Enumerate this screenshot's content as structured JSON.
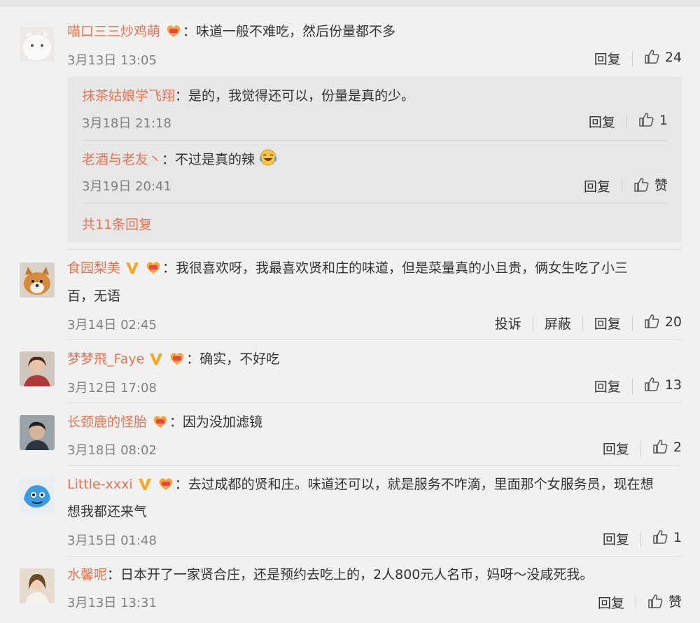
{
  "comments": [
    {
      "user": "喵口三三炒鸡萌",
      "text": "：味道一般不难吃，然后份量都不多",
      "time": "3月13日 13:05",
      "actions": [
        "回复"
      ],
      "likes": "24",
      "replies": [
        {
          "user": "抹茶姑娘学飞翔",
          "text": "：是的，我觉得还可以，份量是真的少。",
          "time": "3月18日 21:18",
          "reply": "回复",
          "likes": "1"
        },
        {
          "user": "老酒与老友丶",
          "text": "：不过是真的辣",
          "time": "3月19日 20:41",
          "reply": "回复",
          "likes": "赞"
        }
      ],
      "more_replies": "共11条回复"
    },
    {
      "user": "食园梨美",
      "text": "：我很喜欢呀，我最喜欢贤和庄的味道，但是菜量真的小且贵，俩女生吃了小三",
      "text2": "百，无语",
      "time": "3月14日 02:45",
      "actions": [
        "投诉",
        "屏蔽",
        "回复"
      ],
      "likes": "20"
    },
    {
      "user": "梦梦飛_Faye",
      "text": "：确实，不好吃",
      "time": "3月12日 17:08",
      "actions": [
        "回复"
      ],
      "likes": "13"
    },
    {
      "user": "长颈鹿的怪胎",
      "text": "：因为没加滤镜",
      "time": "3月18日 08:02",
      "actions": [
        "回复"
      ],
      "likes": "2"
    },
    {
      "user": "Little-xxxi",
      "text": "：去过成都的贤和庄。味道还可以，就是服务不咋滴，里面那个女服务员，现在想",
      "text2": "想我都还来气",
      "time": "3月15日 01:48",
      "actions": [
        "回复"
      ],
      "likes": "1"
    },
    {
      "user": "水馨呢",
      "text": "：日本开了一家贤合庄，还是预约去吃上的，2人800元人名币，妈呀～没咸死我。",
      "time": "3月13日 13:31",
      "actions": [
        "回复"
      ],
      "likes": "赞"
    }
  ],
  "colors": {
    "username": "#eb7350",
    "meta": "#808080",
    "background": "#f1f1f1",
    "reply_bg": "#e7e7e7",
    "vip_v": "#f5a623"
  },
  "icons": [
    "vip-v-icon",
    "fan-badge-icon",
    "thumbs-up-icon",
    "laugh-cry-emoji-icon"
  ]
}
